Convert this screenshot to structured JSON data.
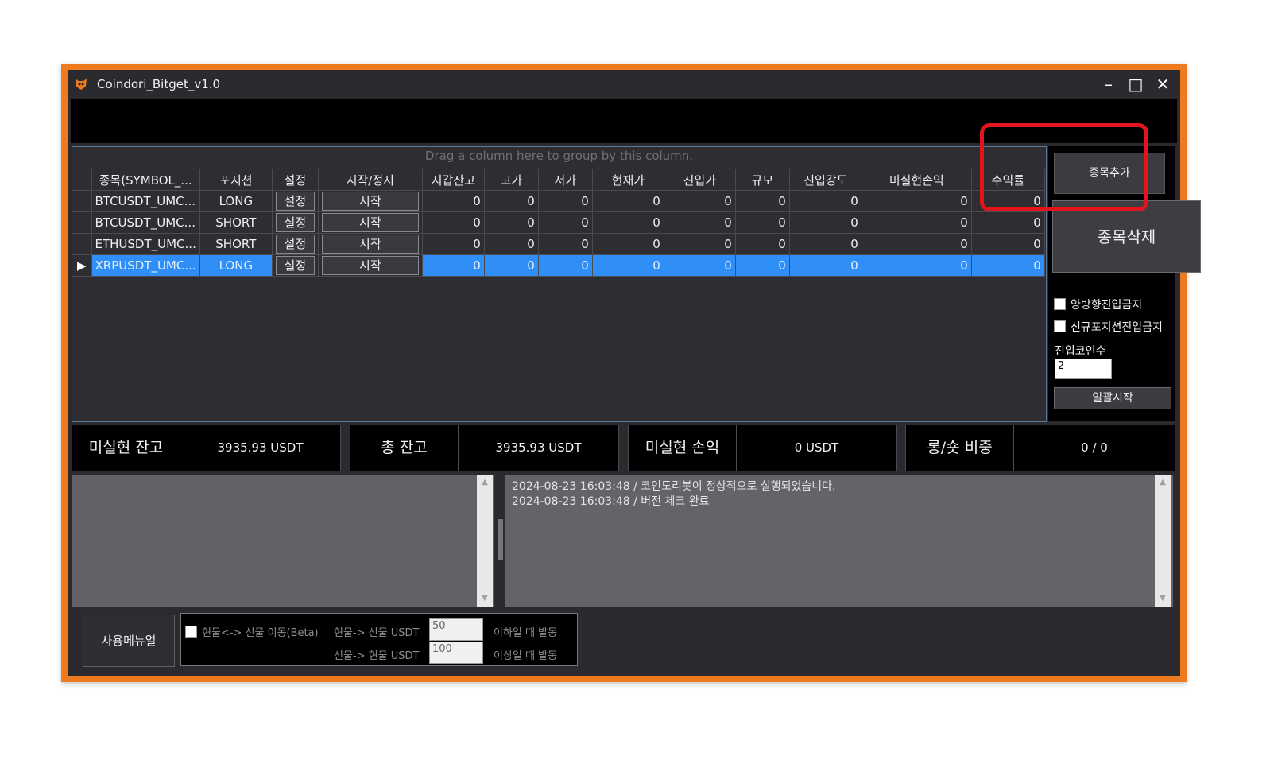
{
  "window": {
    "title": "Coindori_Bitget_v1.0",
    "minimize": "–",
    "maximize": "□",
    "close": "✕"
  },
  "grid": {
    "group_hint": "Drag a column here to group by this column.",
    "columns": [
      "종목(SYMBOL_...",
      "포지션",
      "설정",
      "시작/정지",
      "지갑잔고",
      "고가",
      "저가",
      "현재가",
      "진입가",
      "규모",
      "진입강도",
      "미실현손익",
      "수익률"
    ],
    "rows": [
      {
        "symbol": "BTCUSDT_UMC...",
        "position": "LONG",
        "settings": "설정",
        "startstop": "시작",
        "wallet": "0",
        "high": "0",
        "low": "0",
        "price": "0",
        "entry": "0",
        "size": "0",
        "strength": "0",
        "unrealized": "0",
        "roi": "0",
        "selected": false
      },
      {
        "symbol": "BTCUSDT_UMC...",
        "position": "SHORT",
        "settings": "설정",
        "startstop": "시작",
        "wallet": "0",
        "high": "0",
        "low": "0",
        "price": "0",
        "entry": "0",
        "size": "0",
        "strength": "0",
        "unrealized": "0",
        "roi": "0",
        "selected": false
      },
      {
        "symbol": "ETHUSDT_UMC...",
        "position": "SHORT",
        "settings": "설정",
        "startstop": "시작",
        "wallet": "0",
        "high": "0",
        "low": "0",
        "price": "0",
        "entry": "0",
        "size": "0",
        "strength": "0",
        "unrealized": "0",
        "roi": "0",
        "selected": false
      },
      {
        "symbol": "XRPUSDT_UMC...",
        "position": "LONG",
        "settings": "설정",
        "startstop": "시작",
        "wallet": "0",
        "high": "0",
        "low": "0",
        "price": "0",
        "entry": "0",
        "size": "0",
        "strength": "0",
        "unrealized": "0",
        "roi": "0",
        "selected": true
      }
    ]
  },
  "right_panel": {
    "add_symbol": "종목추가",
    "delete_symbol": "종목삭제",
    "hedge_block": "양방향진입금지",
    "new_position_block": "신규포지션진입금지",
    "coin_count_label": "진입코인수",
    "coin_count_value": "2",
    "bulk_start": "일괄시작"
  },
  "stats": {
    "unrealized_balance_label": "미실현 잔고",
    "unrealized_balance_value": "3935.93 USDT",
    "total_balance_label": "총 잔고",
    "total_balance_value": "3935.93 USDT",
    "unrealized_pnl_label": "미실현 손익",
    "unrealized_pnl_value": "0 USDT",
    "long_short_label": "롱/숏 비중",
    "long_short_value": "0 / 0"
  },
  "logs": [
    "2024-08-23 16:03:48 / 코인도리봇이 정상적으로 실행되었습니다.",
    "2024-08-23 16:03:48 / 버전 체크 완료"
  ],
  "bottom": {
    "manual_button": "사용메뉴얼",
    "transfer_label": "현물<-> 선물 이동(Beta)",
    "spot_to_futures_label": "현물-> 선물 USDT",
    "spot_to_futures_value": "50",
    "below_trigger": "이하일 때 발동",
    "futures_to_spot_label": "선물-> 현물 USDT",
    "futures_to_spot_value": "100",
    "above_trigger": "이상일 때 발동"
  },
  "colors": {
    "accent_frame": "#f07a1f",
    "selection": "#2f8ff7",
    "highlight_box": "#e2151c"
  }
}
